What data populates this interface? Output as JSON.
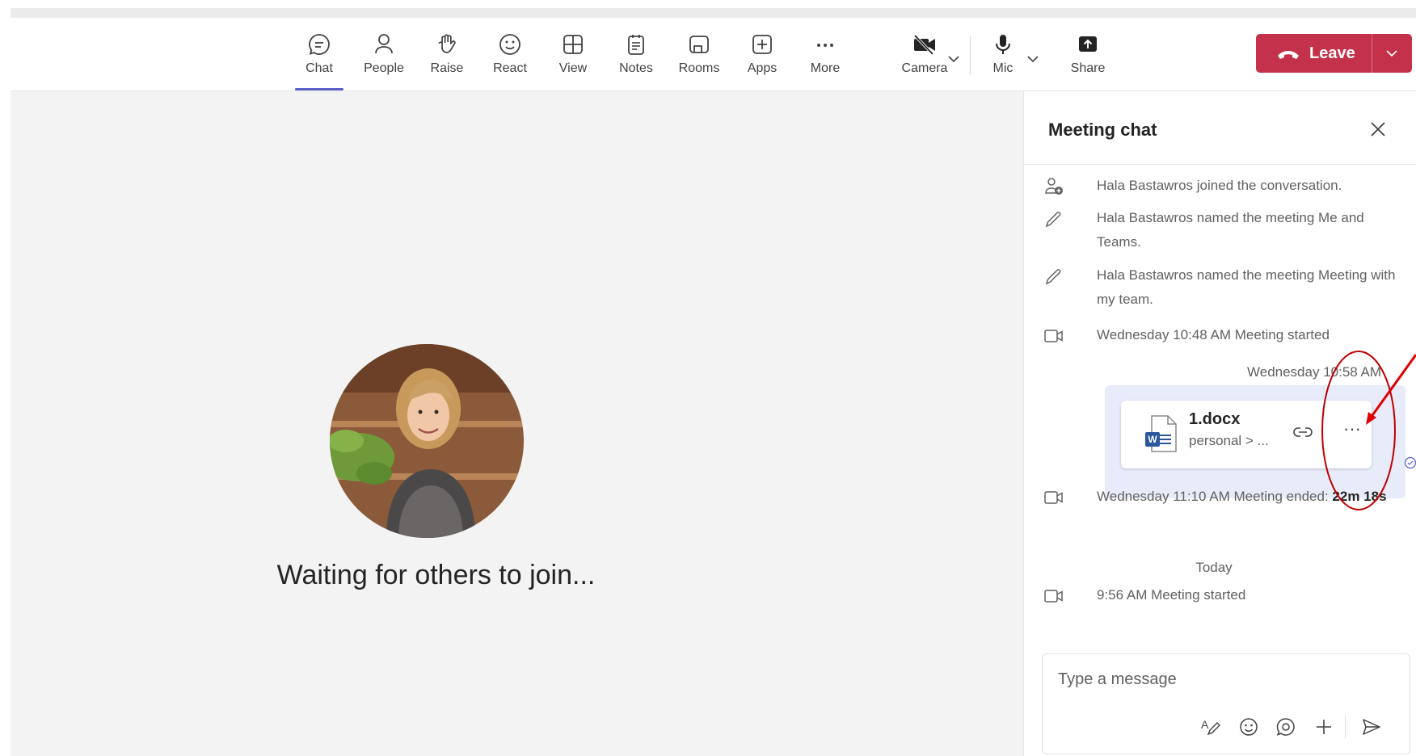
{
  "toolbar": {
    "buttons": [
      {
        "label": "Chat",
        "icon": "chat-icon"
      },
      {
        "label": "People",
        "icon": "people-icon"
      },
      {
        "label": "Raise",
        "icon": "raise-hand-icon"
      },
      {
        "label": "React",
        "icon": "smiley-icon"
      },
      {
        "label": "View",
        "icon": "view-grid-icon"
      },
      {
        "label": "Notes",
        "icon": "notes-icon"
      },
      {
        "label": "Rooms",
        "icon": "rooms-icon"
      },
      {
        "label": "Apps",
        "icon": "apps-plus-icon"
      },
      {
        "label": "More",
        "icon": "more-icon"
      },
      {
        "label": "Camera",
        "icon": "camera-off-icon"
      },
      {
        "label": "Mic",
        "icon": "mic-icon"
      },
      {
        "label": "Share",
        "icon": "share-icon"
      }
    ],
    "leave_label": "Leave",
    "leave_color": "#c4314b",
    "active_tab_color": "#5b5fc7"
  },
  "stage": {
    "waiting_text": "Waiting for others to join..."
  },
  "chat": {
    "title": "Meeting chat",
    "events": [
      {
        "icon": "person-add-icon",
        "text": "Hala Bastawros joined the conversation."
      },
      {
        "icon": "pencil-icon",
        "text": "Hala Bastawros named the meeting Me and Teams."
      },
      {
        "icon": "pencil-icon",
        "text": "Hala Bastawros named the meeting Meeting with my team."
      },
      {
        "icon": "video-icon",
        "text": "Wednesday 10:48 AM   Meeting started"
      }
    ],
    "message_timestamp": "Wednesday 10:58 AM",
    "file": {
      "name": "1.docx",
      "path": "personal > ...",
      "more": "···"
    },
    "ended": {
      "text": "Wednesday 11:10 AM   Meeting ended: ",
      "duration": "22m 18s"
    },
    "day_divider": "Today",
    "started_today": "9:56 AM   Meeting started",
    "compose_placeholder": "Type a message"
  }
}
